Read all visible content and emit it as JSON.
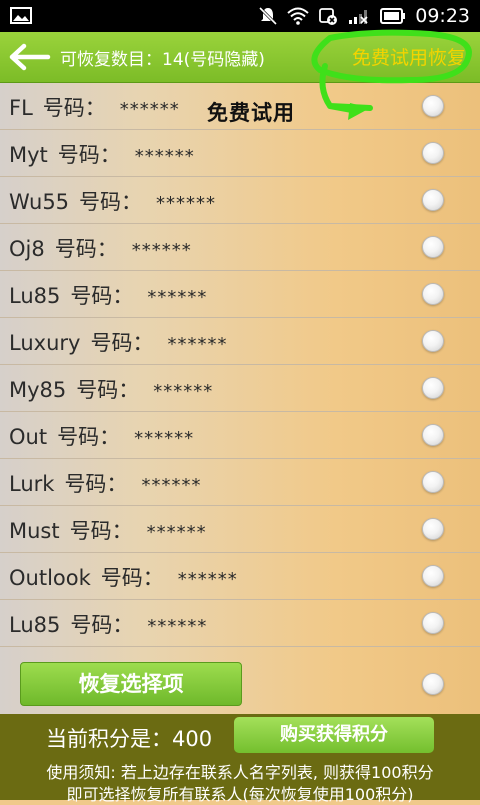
{
  "status_bar": {
    "time": "09:23",
    "icons": [
      "image-icon",
      "mute-icon",
      "wifi-icon",
      "sync-icon",
      "signal-icon",
      "battery-icon"
    ]
  },
  "header": {
    "back_icon": "arrow-left-icon",
    "title": "可恢复数目：14(号码隐藏)",
    "trial_button": "免费试用恢复"
  },
  "annotation": {
    "text": "免费试用",
    "color": "#3fe01a"
  },
  "contacts": [
    {
      "name": "FL",
      "label": "号码：",
      "number": "******"
    },
    {
      "name": "Myt",
      "label": "号码：",
      "number": "******"
    },
    {
      "name": "Wu55",
      "label": "号码：",
      "number": "******"
    },
    {
      "name": "Oj8",
      "label": "号码：",
      "number": "******"
    },
    {
      "name": "Lu85",
      "label": "号码：",
      "number": "******"
    },
    {
      "name": "Luxury",
      "label": "号码：",
      "number": "******"
    },
    {
      "name": "My85",
      "label": "号码：",
      "number": "******"
    },
    {
      "name": "Out",
      "label": "号码：",
      "number": "******"
    },
    {
      "name": "Lurk",
      "label": "号码：",
      "number": "******"
    },
    {
      "name": "Must",
      "label": "号码：",
      "number": "******"
    },
    {
      "name": "Outlook",
      "label": "号码：",
      "number": "******"
    },
    {
      "name": "Lu85",
      "label": "号码：",
      "number": "******"
    }
  ],
  "actions": {
    "restore_selected": "恢复选择项"
  },
  "footer": {
    "points_text": "当前积分是：400",
    "buy_button": "购买获得积分",
    "note_line1": "使用须知: 若上边存在联系人名字列表, 则获得100积分",
    "note_line2": "即可选择恢复所有联系人(每次恢复使用100积分)"
  },
  "colors": {
    "header_green": "#8cc733",
    "trial_yellow": "#f3d400",
    "footer_olive": "#6b6b12"
  }
}
